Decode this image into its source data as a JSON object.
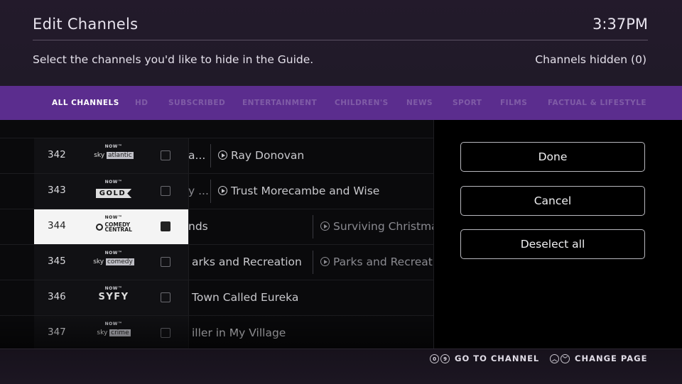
{
  "header": {
    "title": "Edit Channels",
    "time": "3:37PM",
    "subtitle": "Select the channels you'd like to hide in the Guide.",
    "channels_hidden": "Channels hidden (0)"
  },
  "tabs": [
    {
      "label": "ALL CHANNELS",
      "active": true
    },
    {
      "label": "HD"
    },
    {
      "label": "SUBSCRIBED"
    },
    {
      "label": "ENTERTAINMENT"
    },
    {
      "label": "CHILDREN'S"
    },
    {
      "label": "NEWS"
    },
    {
      "label": "SPORT"
    },
    {
      "label": "FILMS"
    },
    {
      "label": "FACTUAL & LIFESTYLE"
    }
  ],
  "channels": [
    {
      "number": "342",
      "logo_top": "NOW™",
      "logo_brand": "sky",
      "logo_tag": "atlantic",
      "checked": false,
      "prog1": "a...",
      "prog2": "Ray Donovan"
    },
    {
      "number": "343",
      "logo_top": "NOW™",
      "logo_brand": "GOLD",
      "checked": false,
      "prog1": "y ...",
      "prog2": "Trust Morecambe and Wise"
    },
    {
      "number": "344",
      "logo_top": "NOW™",
      "logo_brand": "COMEDY CENTRAL",
      "checked": true,
      "prog1": "nds",
      "prog2": "Surviving Christmas"
    },
    {
      "number": "345",
      "logo_top": "NOW™",
      "logo_brand": "sky",
      "logo_tag": "comedy",
      "checked": false,
      "prog1": "arks and Recreation",
      "prog2": "Parks and Recreation"
    },
    {
      "number": "346",
      "logo_top": "NOW™",
      "logo_brand": "SYFY",
      "checked": false,
      "prog1": "Town Called Eureka",
      "prog2": ""
    },
    {
      "number": "347",
      "logo_top": "NOW™",
      "logo_brand": "sky",
      "logo_tag": "crime",
      "checked": false,
      "prog1": "iller in My Village",
      "prog2": ""
    }
  ],
  "actions": {
    "done": "Done",
    "cancel": "Cancel",
    "deselect_all": "Deselect all"
  },
  "footer": {
    "key_0": "0",
    "key_9": "9",
    "go_to_channel": "GO TO CHANNEL",
    "change_page": "CHANGE PAGE"
  },
  "colors": {
    "accent": "#5b2d8e",
    "header_bg": "#231a2b"
  }
}
